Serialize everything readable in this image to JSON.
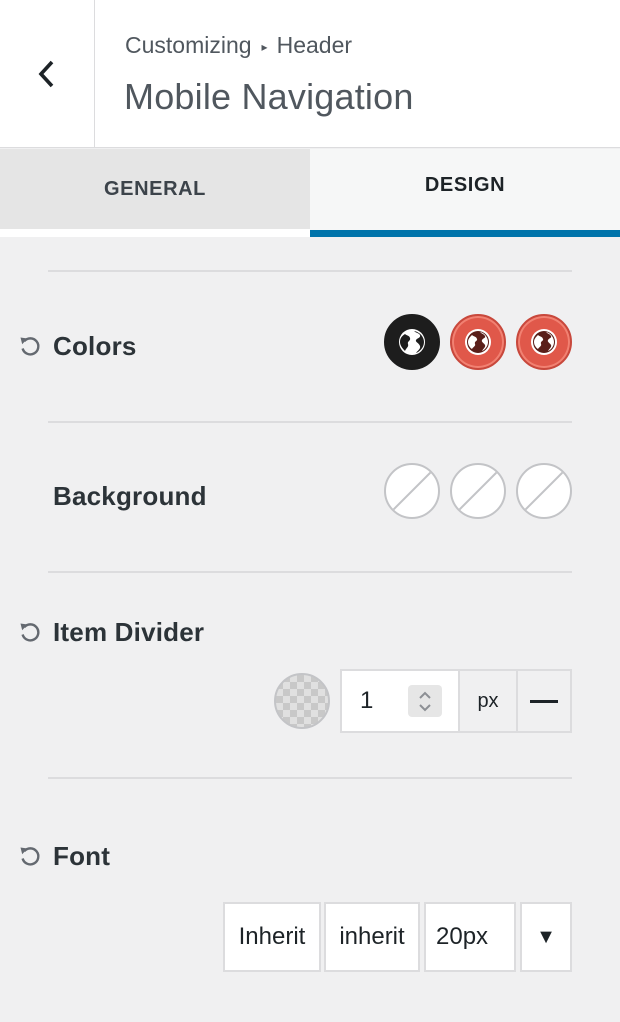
{
  "header": {
    "breadcrumb": [
      "Customizing",
      "Header"
    ],
    "breadcrumb_separator": "▸",
    "title": "Mobile Navigation",
    "back_icon": "chevron-left-icon"
  },
  "tabs": [
    {
      "label": "GENERAL",
      "active": false
    },
    {
      "label": "DESIGN",
      "active": true
    }
  ],
  "colors_accent": {
    "active_tab_underline": "#0073aa",
    "swatch_dark": "#1d1d1d",
    "swatch_red": "#e0584a"
  },
  "sections": {
    "colors": {
      "label": "Colors",
      "swatches": [
        {
          "icon": "globe-icon",
          "color": "#1d1d1d"
        },
        {
          "icon": "globe-icon",
          "color": "#e0584a"
        },
        {
          "icon": "globe-icon",
          "color": "#e0584a"
        }
      ]
    },
    "background": {
      "label": "Background",
      "swatches": [
        "empty",
        "empty",
        "empty"
      ]
    },
    "item_divider": {
      "label": "Item Divider",
      "width_value": "1",
      "unit": "px",
      "style_icon": "line-solid-icon"
    },
    "font": {
      "label": "Font",
      "family": "Inherit",
      "weight": "inherit",
      "size": "20px",
      "toggle": "▼"
    }
  }
}
